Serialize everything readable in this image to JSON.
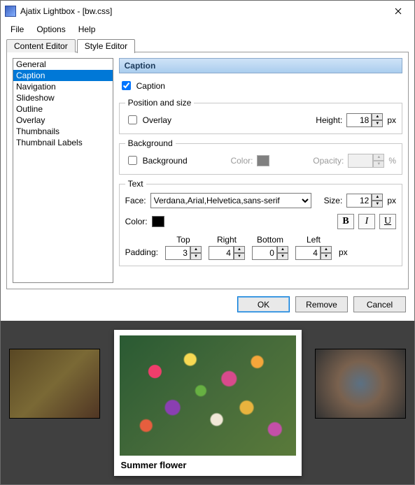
{
  "title": "Ajatix Lightbox - [bw.css]",
  "menu": {
    "file": "File",
    "options": "Options",
    "help": "Help"
  },
  "tabs": {
    "content": "Content Editor",
    "style": "Style Editor"
  },
  "categories": [
    "General",
    "Caption",
    "Navigation",
    "Slideshow",
    "Outline",
    "Overlay",
    "Thumbnails",
    "Thumbnail Labels"
  ],
  "panel": {
    "header": "Caption",
    "caption_label": "Caption",
    "pos_legend": "Position and size",
    "overlay_label": "Overlay",
    "height_label": "Height:",
    "height_value": "18",
    "unit_px": "px",
    "bg_legend": "Background",
    "bg_label": "Background",
    "color_label": "Color:",
    "opacity_label": "Opacity:",
    "opacity_value": "",
    "unit_pct": "%",
    "text_legend": "Text",
    "face_label": "Face:",
    "face_value": "Verdana,Arial,Helvetica,sans-serif",
    "size_label": "Size:",
    "size_value": "12",
    "textcolor_label": "Color:",
    "bold": "B",
    "italic": "I",
    "underline": "U",
    "padding_label": "Padding:",
    "pad_top": "Top",
    "pad_right": "Right",
    "pad_bottom": "Bottom",
    "pad_left": "Left",
    "pad_top_v": "3",
    "pad_right_v": "4",
    "pad_bottom_v": "0",
    "pad_left_v": "4"
  },
  "buttons": {
    "ok": "OK",
    "remove": "Remove",
    "cancel": "Cancel"
  },
  "preview": {
    "caption": "Summer flower"
  }
}
